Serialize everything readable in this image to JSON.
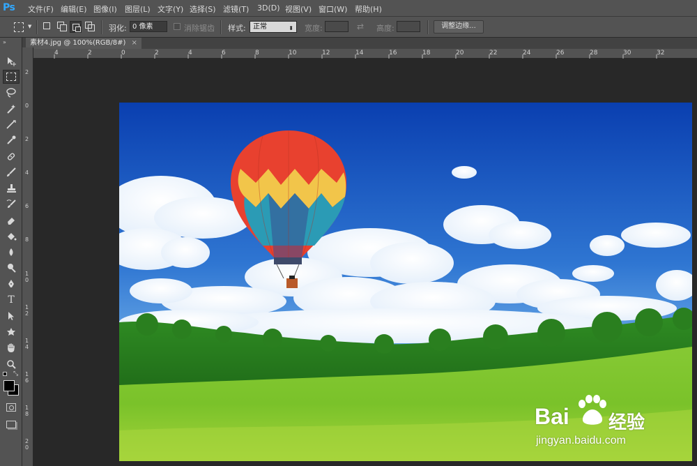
{
  "app": {
    "logo": "Ps"
  },
  "menubar": {
    "items": [
      "文件(F)",
      "编辑(E)",
      "图像(I)",
      "图层(L)",
      "文字(Y)",
      "选择(S)",
      "滤镜(T)",
      "3D(D)",
      "视图(V)",
      "窗口(W)",
      "帮助(H)"
    ]
  },
  "options_bar": {
    "feather_label": "羽化:",
    "feather_value": "0 像素",
    "antialias_label": "消除锯齿",
    "style_label": "样式:",
    "style_value": "正常",
    "width_label": "宽度:",
    "height_label": "高度:",
    "refine_edge_button": "调整边缘..."
  },
  "document": {
    "tab_title": "素材4.jpg @ 100%(RGB/8#)",
    "close_glyph": "×"
  },
  "rulers": {
    "horizontal": [
      "4",
      "2",
      "0",
      "2",
      "4",
      "6",
      "8",
      "10",
      "12",
      "14",
      "16",
      "18",
      "20",
      "22",
      "24",
      "26",
      "28",
      "30",
      "32"
    ],
    "vertical": [
      "2",
      "0",
      "2",
      "4",
      "6",
      "8",
      "1 0",
      "1 2",
      "1 4",
      "1 6",
      "1 8",
      "2 0"
    ]
  },
  "toolbox": {
    "tools": [
      "move-tool",
      "marquee-tool",
      "lasso-tool",
      "quick-select-tool",
      "crop-tool",
      "eyedropper-tool",
      "healing-brush-tool",
      "brush-tool",
      "clone-stamp-tool",
      "history-brush-tool",
      "eraser-tool",
      "paint-bucket-tool",
      "blur-tool",
      "dodge-tool",
      "pen-tool",
      "type-tool",
      "path-select-tool",
      "shape-tool",
      "hand-tool",
      "zoom-tool"
    ]
  },
  "watermark": {
    "brand": "Bai",
    "brand2": "经验",
    "url": "jingyan.baidu.com"
  },
  "colors": {
    "chrome": "#535353",
    "canvas_bg": "#282828",
    "sky_top": "#0a3fb0",
    "grass": "#7ecb2c"
  }
}
